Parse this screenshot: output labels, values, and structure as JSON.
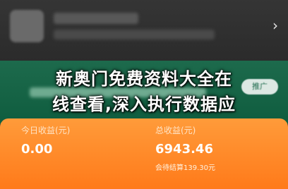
{
  "header": {
    "chevron": "›"
  },
  "promo": {
    "pill_label": "推广"
  },
  "stats": {
    "today_label": "今日收益(元)",
    "today_value": "0.00",
    "total_label": "总收益(元)",
    "total_value": "6943.46",
    "pending_note": "会待结算139.30元"
  },
  "overlay": {
    "line1": "新奥门免费资料大全在",
    "line2": "线查看,深入执行数据应"
  },
  "colors": {
    "green": "#1d6a4c",
    "orange": "#ff8a28"
  }
}
